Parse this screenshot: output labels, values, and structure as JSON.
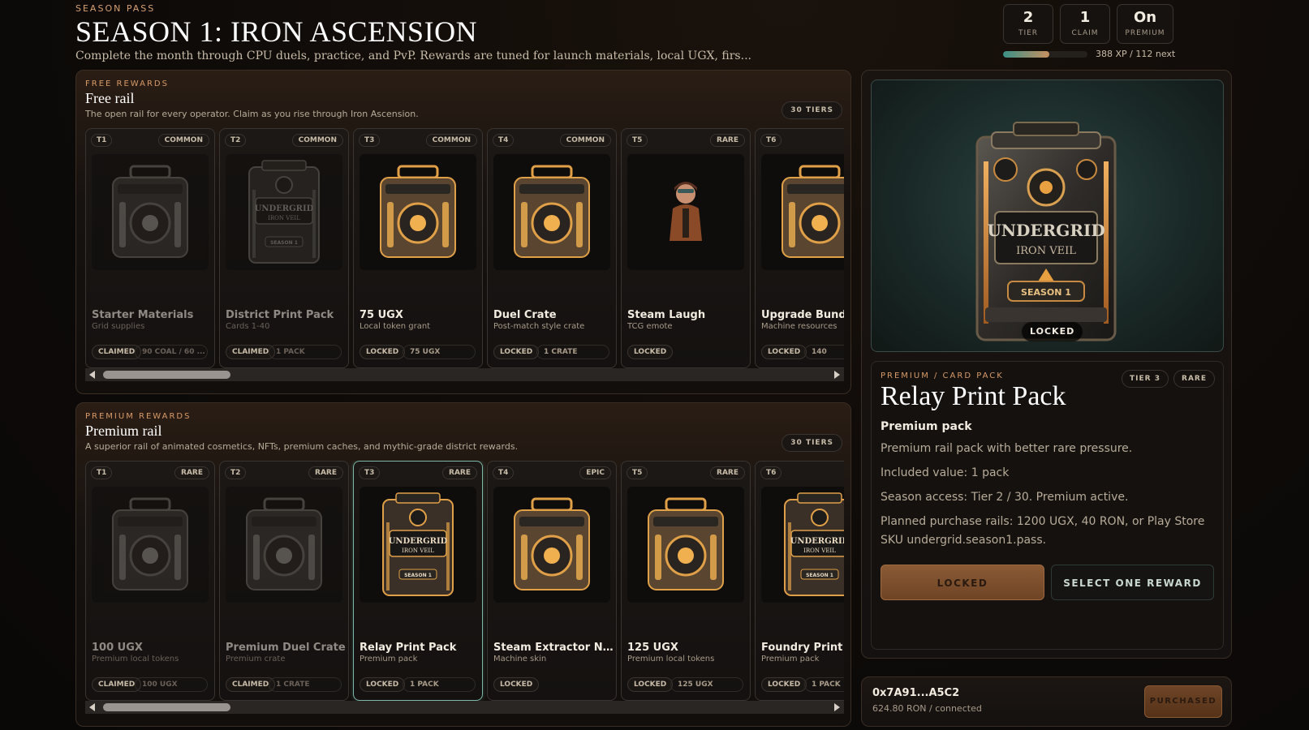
{
  "header": {
    "eyebrow": "SEASON PASS",
    "title": "SEASON 1: IRON ASCENSION",
    "subtitle": "Complete the month through CPU duels, practice, and PvP. Rewards are tuned for launch materials, local UGX, firs..."
  },
  "stats": [
    {
      "value": "2",
      "label": "TIER"
    },
    {
      "value": "1",
      "label": "CLAIM"
    },
    {
      "value": "On",
      "label": "PREMIUM"
    }
  ],
  "xp": {
    "text": "388 XP / 112 next",
    "progress": 0.55
  },
  "free_rail": {
    "eyebrow": "FREE REWARDS",
    "title": "Free rail",
    "description": "The open rail for every operator. Claim as you rise through Iron Ascension.",
    "tiers_label": "30 TIERS",
    "cards": [
      {
        "tier": "T1",
        "rarity": "COMMON",
        "title": "Starter Materials",
        "subtitle": "Grid supplies",
        "status": "CLAIMED",
        "amount": "90 COAL / 60 ...",
        "art": "crate-dark",
        "claimed": true
      },
      {
        "tier": "T2",
        "rarity": "COMMON",
        "title": "District Print Pack",
        "subtitle": "Cards 1-40",
        "status": "CLAIMED",
        "amount": "1 PACK",
        "art": "pack-dark",
        "claimed": true
      },
      {
        "tier": "T3",
        "rarity": "COMMON",
        "title": "75 UGX",
        "subtitle": "Local token grant",
        "status": "LOCKED",
        "amount": "75 UGX",
        "art": "crate-gold",
        "claimed": false
      },
      {
        "tier": "T4",
        "rarity": "COMMON",
        "title": "Duel Crate",
        "subtitle": "Post-match style crate",
        "status": "LOCKED",
        "amount": "1 CRATE",
        "art": "crate-gold",
        "claimed": false
      },
      {
        "tier": "T5",
        "rarity": "RARE",
        "title": "Steam Laugh",
        "subtitle": "TCG emote",
        "status": "LOCKED",
        "amount": "",
        "art": "emote",
        "claimed": false
      },
      {
        "tier": "T6",
        "rarity": "",
        "title": "Upgrade Bundle",
        "subtitle": "Machine resources",
        "status": "LOCKED",
        "amount": "140",
        "art": "crate-gold",
        "claimed": false
      }
    ]
  },
  "premium_rail": {
    "eyebrow": "PREMIUM REWARDS",
    "title": "Premium rail",
    "description": "A superior rail of animated cosmetics, NFTs, premium caches, and mythic-grade district rewards.",
    "tiers_label": "30 TIERS",
    "cards": [
      {
        "tier": "T1",
        "rarity": "RARE",
        "title": "100 UGX",
        "subtitle": "Premium local tokens",
        "status": "CLAIMED",
        "amount": "100 UGX",
        "art": "crate-dark",
        "claimed": true
      },
      {
        "tier": "T2",
        "rarity": "RARE",
        "title": "Premium Duel Crate",
        "subtitle": "Premium crate",
        "status": "CLAIMED",
        "amount": "1 CRATE",
        "art": "crate-dark",
        "claimed": true
      },
      {
        "tier": "T3",
        "rarity": "RARE",
        "title": "Relay Print Pack",
        "subtitle": "Premium pack",
        "status": "LOCKED",
        "amount": "1 PACK",
        "art": "pack-gold",
        "claimed": false,
        "selected": true
      },
      {
        "tier": "T4",
        "rarity": "EPIC",
        "title": "Steam Extractor Night...",
        "subtitle": "Machine skin",
        "status": "LOCKED",
        "amount": "",
        "art": "crate-gold",
        "claimed": false
      },
      {
        "tier": "T5",
        "rarity": "RARE",
        "title": "125 UGX",
        "subtitle": "Premium local tokens",
        "status": "LOCKED",
        "amount": "125 UGX",
        "art": "crate-gold",
        "claimed": false
      },
      {
        "tier": "T6",
        "rarity": "",
        "title": "Foundry Print Pack",
        "subtitle": "Premium pack",
        "status": "LOCKED",
        "amount": "1 PACK",
        "art": "pack-gold",
        "claimed": false
      }
    ]
  },
  "detail": {
    "hero_status": "LOCKED",
    "eyebrow": "PREMIUM / CARD PACK",
    "tier_chip": "TIER 3",
    "rarity_chip": "RARE",
    "name": "Relay Print Pack",
    "kind": "Premium pack",
    "description": "Premium rail pack with better rare pressure.",
    "included": "Included value: 1 pack",
    "access": "Season access: Tier 2 / 30. Premium active.",
    "purchase": "Planned purchase rails: 1200 UGX, 40 RON, or Play Store SKU undergrid.season1.pass.",
    "locked_button": "LOCKED",
    "select_button": "SELECT ONE REWARD",
    "pack_brand": "UNDERGRID",
    "pack_line": "IRON VEIL",
    "pack_season": "SEASON 1"
  },
  "wallet": {
    "address": "0x7A91...A5C2",
    "balance": "624.80 RON / connected",
    "purchase_button": "PURCHASED"
  },
  "colors": {
    "accent": "#d89a68",
    "teal": "#7bb8aa",
    "bronze": "#8a5a34"
  }
}
